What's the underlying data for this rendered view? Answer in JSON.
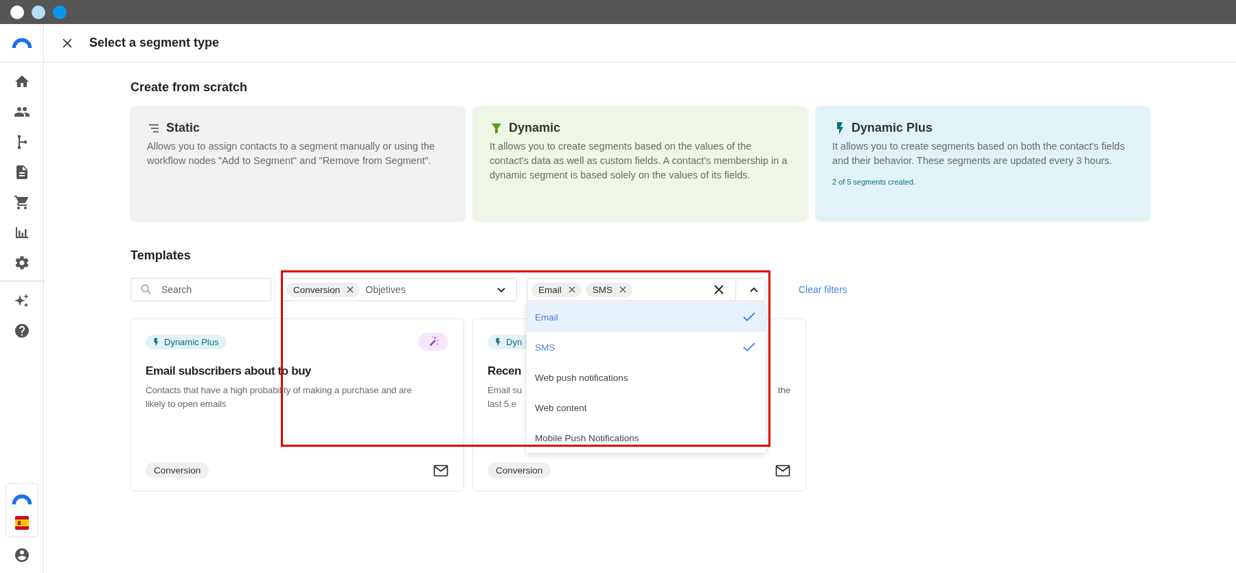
{
  "header": {
    "title": "Select a segment type"
  },
  "scratch": {
    "heading": "Create from scratch",
    "cards": [
      {
        "kind": "static",
        "title": "Static",
        "description": "Allows you to assign contacts to a segment manually or using the workflow nodes \"Add to Segment\" and \"Remove from Segment\"."
      },
      {
        "kind": "dynamic",
        "title": "Dynamic",
        "description": "It allows you to create segments based on the values of the contact's data as well as custom fields. A contact's membership in a dynamic segment is based solely on the values of its fields."
      },
      {
        "kind": "dynamic_plus",
        "title": "Dynamic Plus",
        "description": "It allows you to create segments based on both the contact's fields and their behavior. These segments are updated every 3 hours.",
        "note": "2 of 5 segments created."
      }
    ]
  },
  "templates": {
    "heading": "Templates",
    "search": {
      "placeholder": "Search"
    },
    "objectives": {
      "chips": [
        "Conversion"
      ],
      "placeholder": "Objetives"
    },
    "channels": {
      "chips": [
        "Email",
        "SMS"
      ],
      "expanded": true,
      "options": [
        {
          "label": "Email",
          "selected": true,
          "focused": true
        },
        {
          "label": "SMS",
          "selected": true,
          "focused": false
        },
        {
          "label": "Web push notifications",
          "selected": false,
          "focused": false
        },
        {
          "label": "Web content",
          "selected": false,
          "focused": false
        },
        {
          "label": "Mobile Push Notifications",
          "selected": false,
          "focused": false
        }
      ]
    },
    "clear_filters": "Clear filters",
    "cards": [
      {
        "badge": "Dynamic Plus",
        "featured": true,
        "title": "Email subscribers about to buy",
        "description": "Contacts that have a high probability of making a purchase and are likely to open emails",
        "tag": "Conversion"
      },
      {
        "badge": "Dyn",
        "featured": false,
        "title": "Recen",
        "description_lines": [
          [
            "Email su",
            "the"
          ],
          [
            "last 5 e"
          ]
        ],
        "tag": "Conversion"
      }
    ]
  }
}
